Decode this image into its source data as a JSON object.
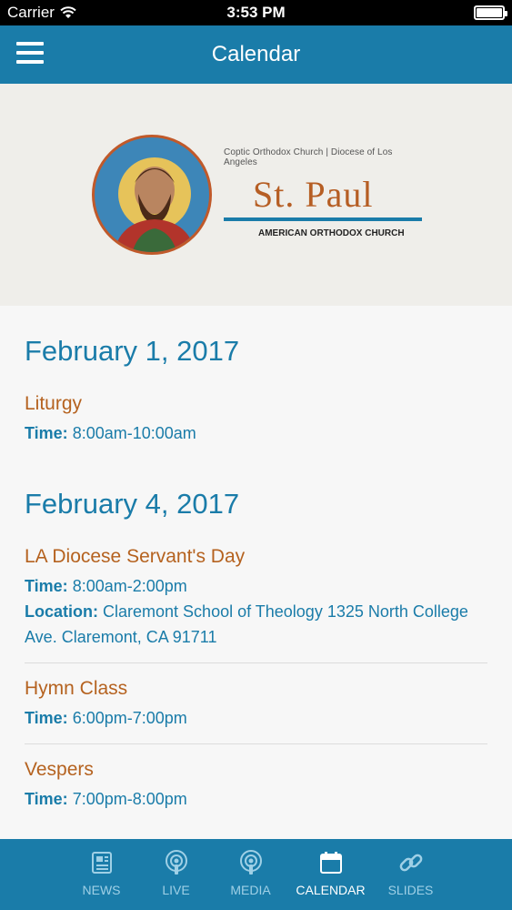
{
  "status_bar": {
    "carrier": "Carrier",
    "time": "3:53 PM"
  },
  "header": {
    "title": "Calendar"
  },
  "banner": {
    "church_line": "Coptic Orthodox Church | Diocese of Los Angeles",
    "name": "St. Paul",
    "subtitle": "AMERICAN ORTHODOX CHURCH"
  },
  "days": [
    {
      "date": "February 1, 2017",
      "events": [
        {
          "title": "Liturgy",
          "time_label": "Time:",
          "time": "8:00am-10:00am"
        }
      ]
    },
    {
      "date": "February 4, 2017",
      "events": [
        {
          "title": "LA Diocese Servant's Day",
          "time_label": "Time:",
          "time": "8:00am-2:00pm",
          "location_label": "Location:",
          "location": "Claremont School of Theology 1325 North College Ave. Claremont, CA 91711"
        },
        {
          "title": "Hymn Class",
          "time_label": "Time:",
          "time": "6:00pm-7:00pm"
        },
        {
          "title": "Vespers",
          "time_label": "Time:",
          "time": "7:00pm-8:00pm"
        }
      ]
    }
  ],
  "tabs": [
    {
      "label": "NEWS",
      "icon": "news-icon"
    },
    {
      "label": "LIVE",
      "icon": "live-icon"
    },
    {
      "label": "MEDIA",
      "icon": "media-icon"
    },
    {
      "label": "CALENDAR",
      "icon": "calendar-icon"
    },
    {
      "label": "SLIDES",
      "icon": "link-icon"
    }
  ],
  "colors": {
    "primary": "#1a7ca9",
    "event_title": "#b5621f",
    "banner_bg": "#efeeea"
  }
}
